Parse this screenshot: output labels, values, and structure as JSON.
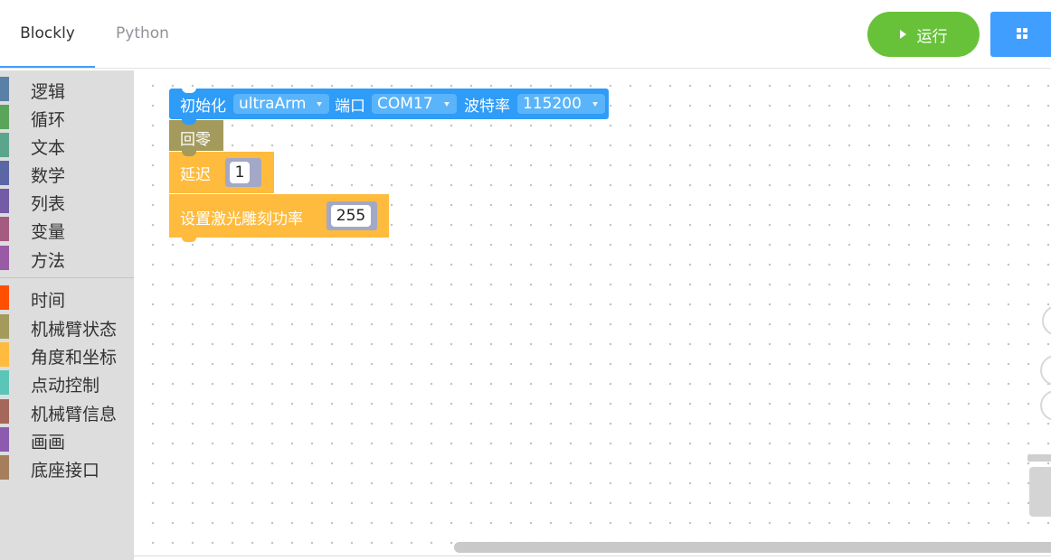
{
  "tabs": [
    {
      "label": "Blockly",
      "active": true
    },
    {
      "label": "Python",
      "active": false
    }
  ],
  "header": {
    "run_label": "运行",
    "run_icon": "play-icon",
    "menu_icon": "grid-icon",
    "accent_color": "#409eff",
    "run_color": "#67c23a"
  },
  "toolbox": {
    "items": [
      {
        "label": "逻辑",
        "color": "#5b80a5"
      },
      {
        "label": "循环",
        "color": "#5ba55b"
      },
      {
        "label": "文本",
        "color": "#5ba58c"
      },
      {
        "label": "数学",
        "color": "#5b67a5"
      },
      {
        "label": "列表",
        "color": "#745ba5"
      },
      {
        "label": "变量",
        "color": "#a55b80"
      },
      {
        "label": "方法",
        "color": "#995ba5"
      },
      {
        "label": "时间",
        "color": "#ff4f00"
      },
      {
        "label": "机械臂状态",
        "color": "#a39a5b"
      },
      {
        "label": "角度和坐标",
        "color": "#ffbb3d"
      },
      {
        "label": "点动控制",
        "color": "#5bc6b8"
      },
      {
        "label": "机械臂信息",
        "color": "#a56759"
      },
      {
        "label": "画画",
        "color": "#8c5bb0"
      },
      {
        "label": "底座接口",
        "color": "#a57f5b"
      }
    ]
  },
  "blocks": {
    "init": {
      "label": "初始化",
      "device": "ultraArm",
      "port_label": "端口",
      "port": "COM17",
      "baud_label": "波特率",
      "baud": "115200",
      "color": "#2f9cf7"
    },
    "home": {
      "label": "回零",
      "color": "#a39a5b"
    },
    "delay": {
      "label": "延迟",
      "value": "1",
      "color": "#ffbb3d"
    },
    "laser": {
      "label": "设置激光雕刻功率",
      "value": "255",
      "color": "#ffbb3d"
    }
  }
}
